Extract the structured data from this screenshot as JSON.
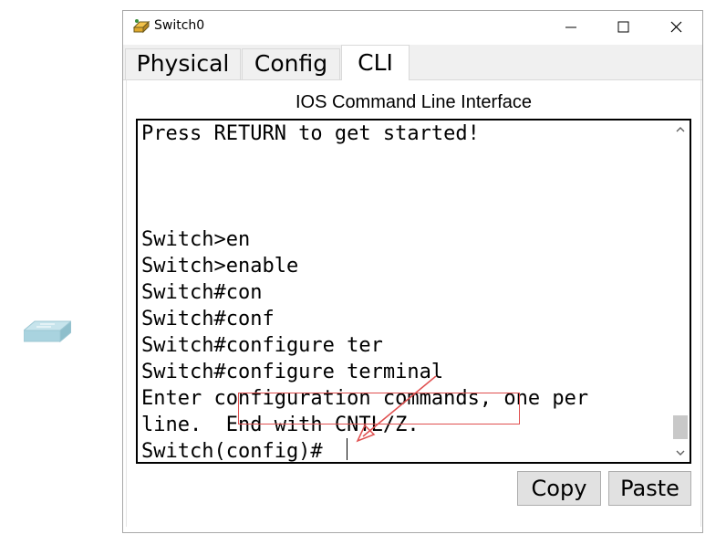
{
  "window": {
    "title": "Switch0",
    "app_icon": "packet-tracer-switch-icon",
    "controls": [
      "minimize-icon",
      "maximize-icon",
      "close-icon"
    ]
  },
  "tabs": [
    {
      "label": "Physical",
      "active": false
    },
    {
      "label": "Config",
      "active": false
    },
    {
      "label": "CLI",
      "active": true
    }
  ],
  "cli": {
    "heading": "IOS Command Line Interface",
    "lines": [
      "Press RETURN to get started!",
      "",
      "",
      "",
      "Switch>en",
      "Switch>enable",
      "Switch#con",
      "Switch#conf",
      "Switch#configure ter",
      "Switch#configure terminal",
      "Enter configuration commands, one per",
      "line.  End with CNTL/Z.",
      "Switch(config)#"
    ]
  },
  "buttons": {
    "copy": "Copy",
    "paste": "Paste"
  },
  "annotation": {
    "color": "#e05050",
    "highlighted_text": "configure terminal"
  },
  "device": {
    "icon": "network-switch-icon",
    "color": "#a9d3df"
  }
}
